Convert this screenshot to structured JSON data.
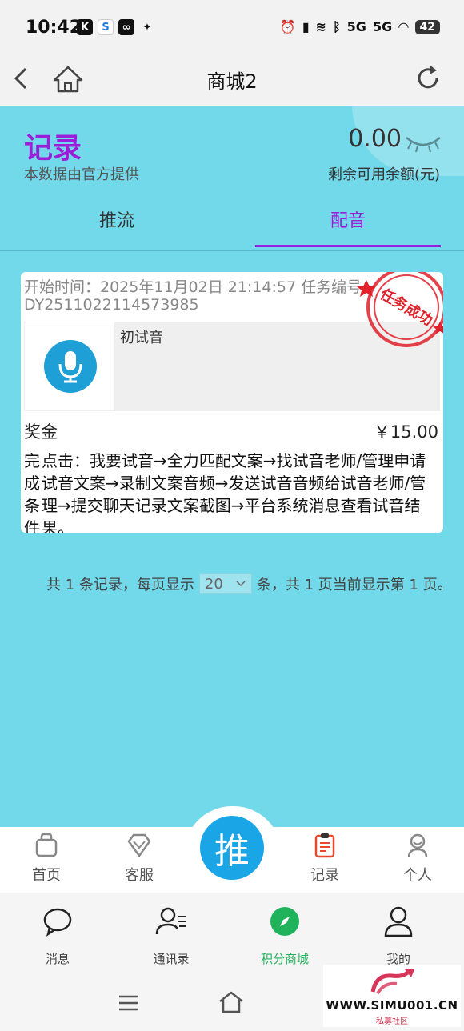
{
  "status_bar": {
    "time": "10:42",
    "battery": "42",
    "signal_labels": [
      "5G",
      "5G"
    ]
  },
  "nav": {
    "title": "商城2"
  },
  "header": {
    "title": "记录",
    "subtitle": "本数据由官方提供",
    "balance": "0.00",
    "balance_label": "剩余可用余额(元)"
  },
  "tabs": [
    {
      "label": "推流",
      "active": false
    },
    {
      "label": "配音",
      "active": true
    }
  ],
  "record": {
    "start_time": "开始时间：2025年11月02日 21:14:57 任务编号：",
    "task_no": "DY2511022114573985",
    "item_name": "初试音",
    "stamp_text": "任务成功",
    "bonus_label": "奖金",
    "bonus_value": "￥15.00",
    "condition_label": "完成条件",
    "description": "点击：我要试音→全力匹配文案→找试音老师/管理申请试音文案→录制文案音频→发送试音音频给试音老师/管理→提交聊天记录文案截图→平台系统消息查看试音结果。"
  },
  "pagination": {
    "prefix": "共 1 条记录，每页显示",
    "page_size": "20",
    "suffix": "条，共 1 页当前显示第 1 页。"
  },
  "app_nav": {
    "center_label": "推",
    "items": [
      {
        "label": "首页"
      },
      {
        "label": "客服"
      },
      {
        "label": "记录"
      },
      {
        "label": "个人"
      }
    ]
  },
  "system_tabs": [
    {
      "label": "消息"
    },
    {
      "label": "通讯录"
    },
    {
      "label": "积分商城",
      "active": true
    },
    {
      "label": "我的"
    }
  ],
  "watermark": {
    "text": "WWW.SIMU001.CN",
    "sub": "私募社区"
  },
  "colors": {
    "page_bg": "#72d9ea",
    "accent_purple": "#9b1ed8",
    "push_blue": "#1aa5e6",
    "active_green": "#21b35c",
    "stamp_red": "#e0202a"
  }
}
